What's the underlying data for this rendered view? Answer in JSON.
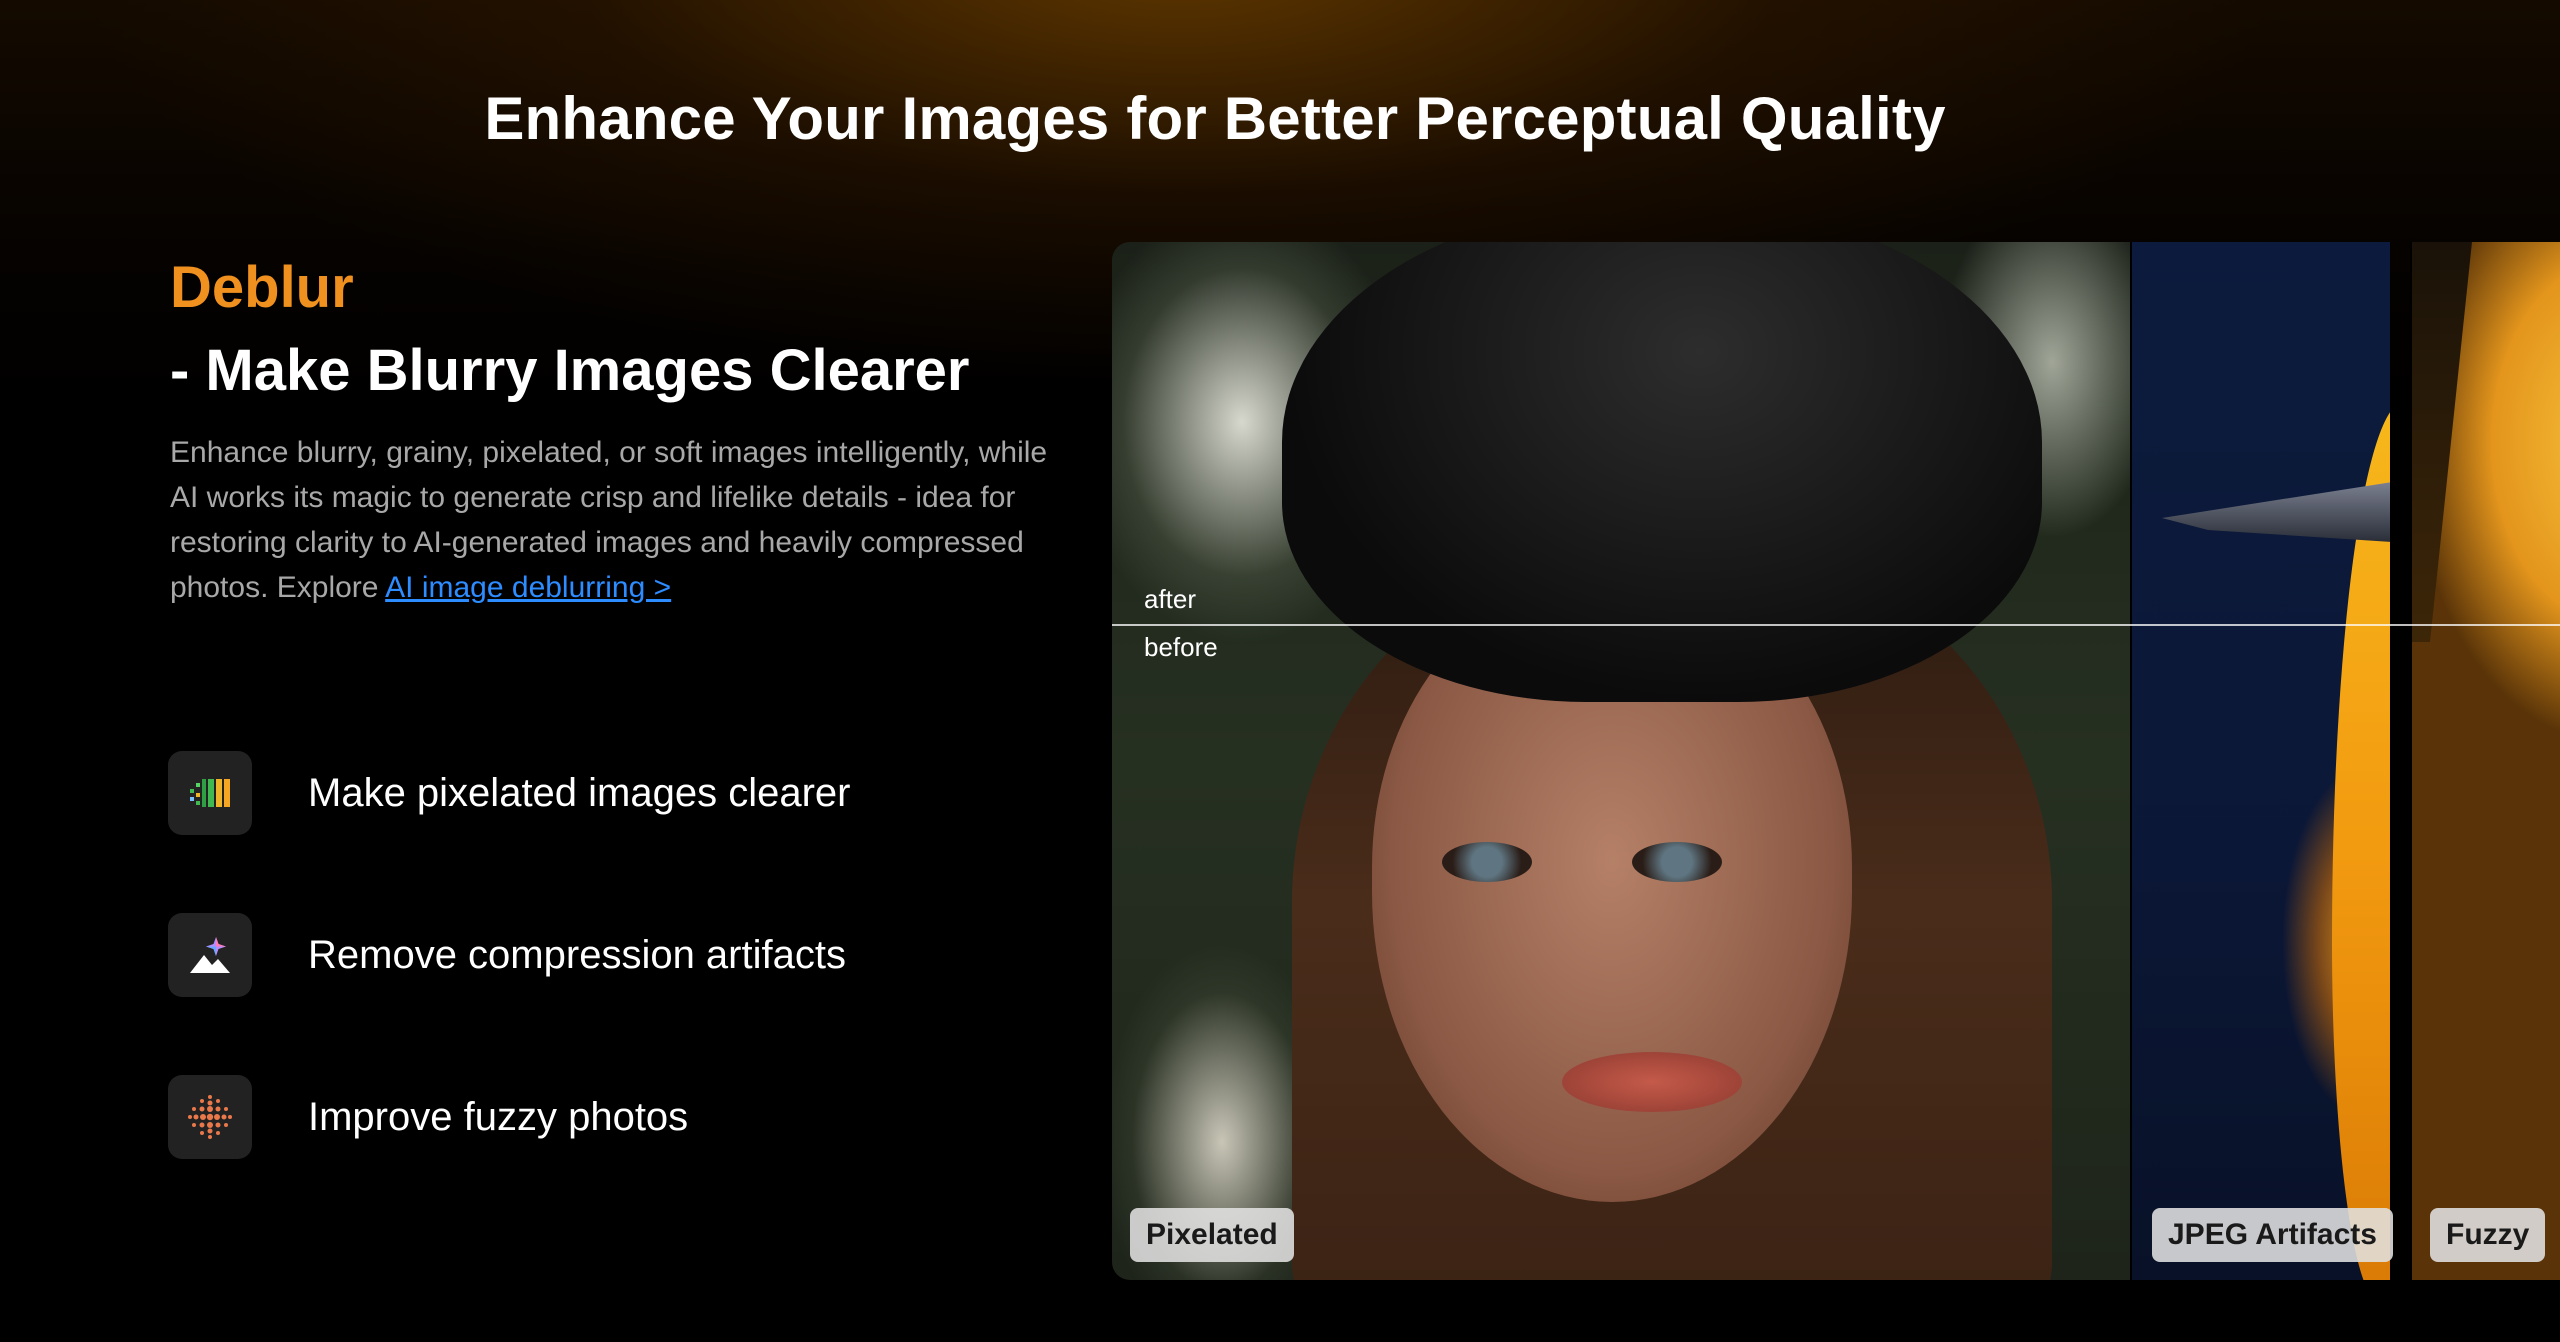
{
  "header": {
    "title": "Enhance Your Images for Better Perceptual Quality"
  },
  "feature": {
    "name": "Deblur",
    "subtitle": "- Make Blurry Images Clearer",
    "description": "Enhance blurry, grainy, pixelated, or soft images intelligently, while AI works its magic to generate crisp and lifelike details - idea for restoring clarity to AI-generated images and heavily compressed photos. Explore ",
    "link_text": "AI image deblurring >"
  },
  "points": [
    {
      "label": "Make pixelated images clearer",
      "icon": "pixel-bars-icon"
    },
    {
      "label": "Remove compression artifacts",
      "icon": "sparkle-mountain-icon"
    },
    {
      "label": "Improve fuzzy photos",
      "icon": "dot-grid-icon"
    }
  ],
  "gallery": {
    "after_label": "after",
    "before_label": "before",
    "tags": [
      "Pixelated",
      "JPEG Artifacts",
      "Fuzzy"
    ]
  },
  "colors": {
    "accent": "#f0911f",
    "link": "#2d8cff",
    "background": "#000000"
  }
}
